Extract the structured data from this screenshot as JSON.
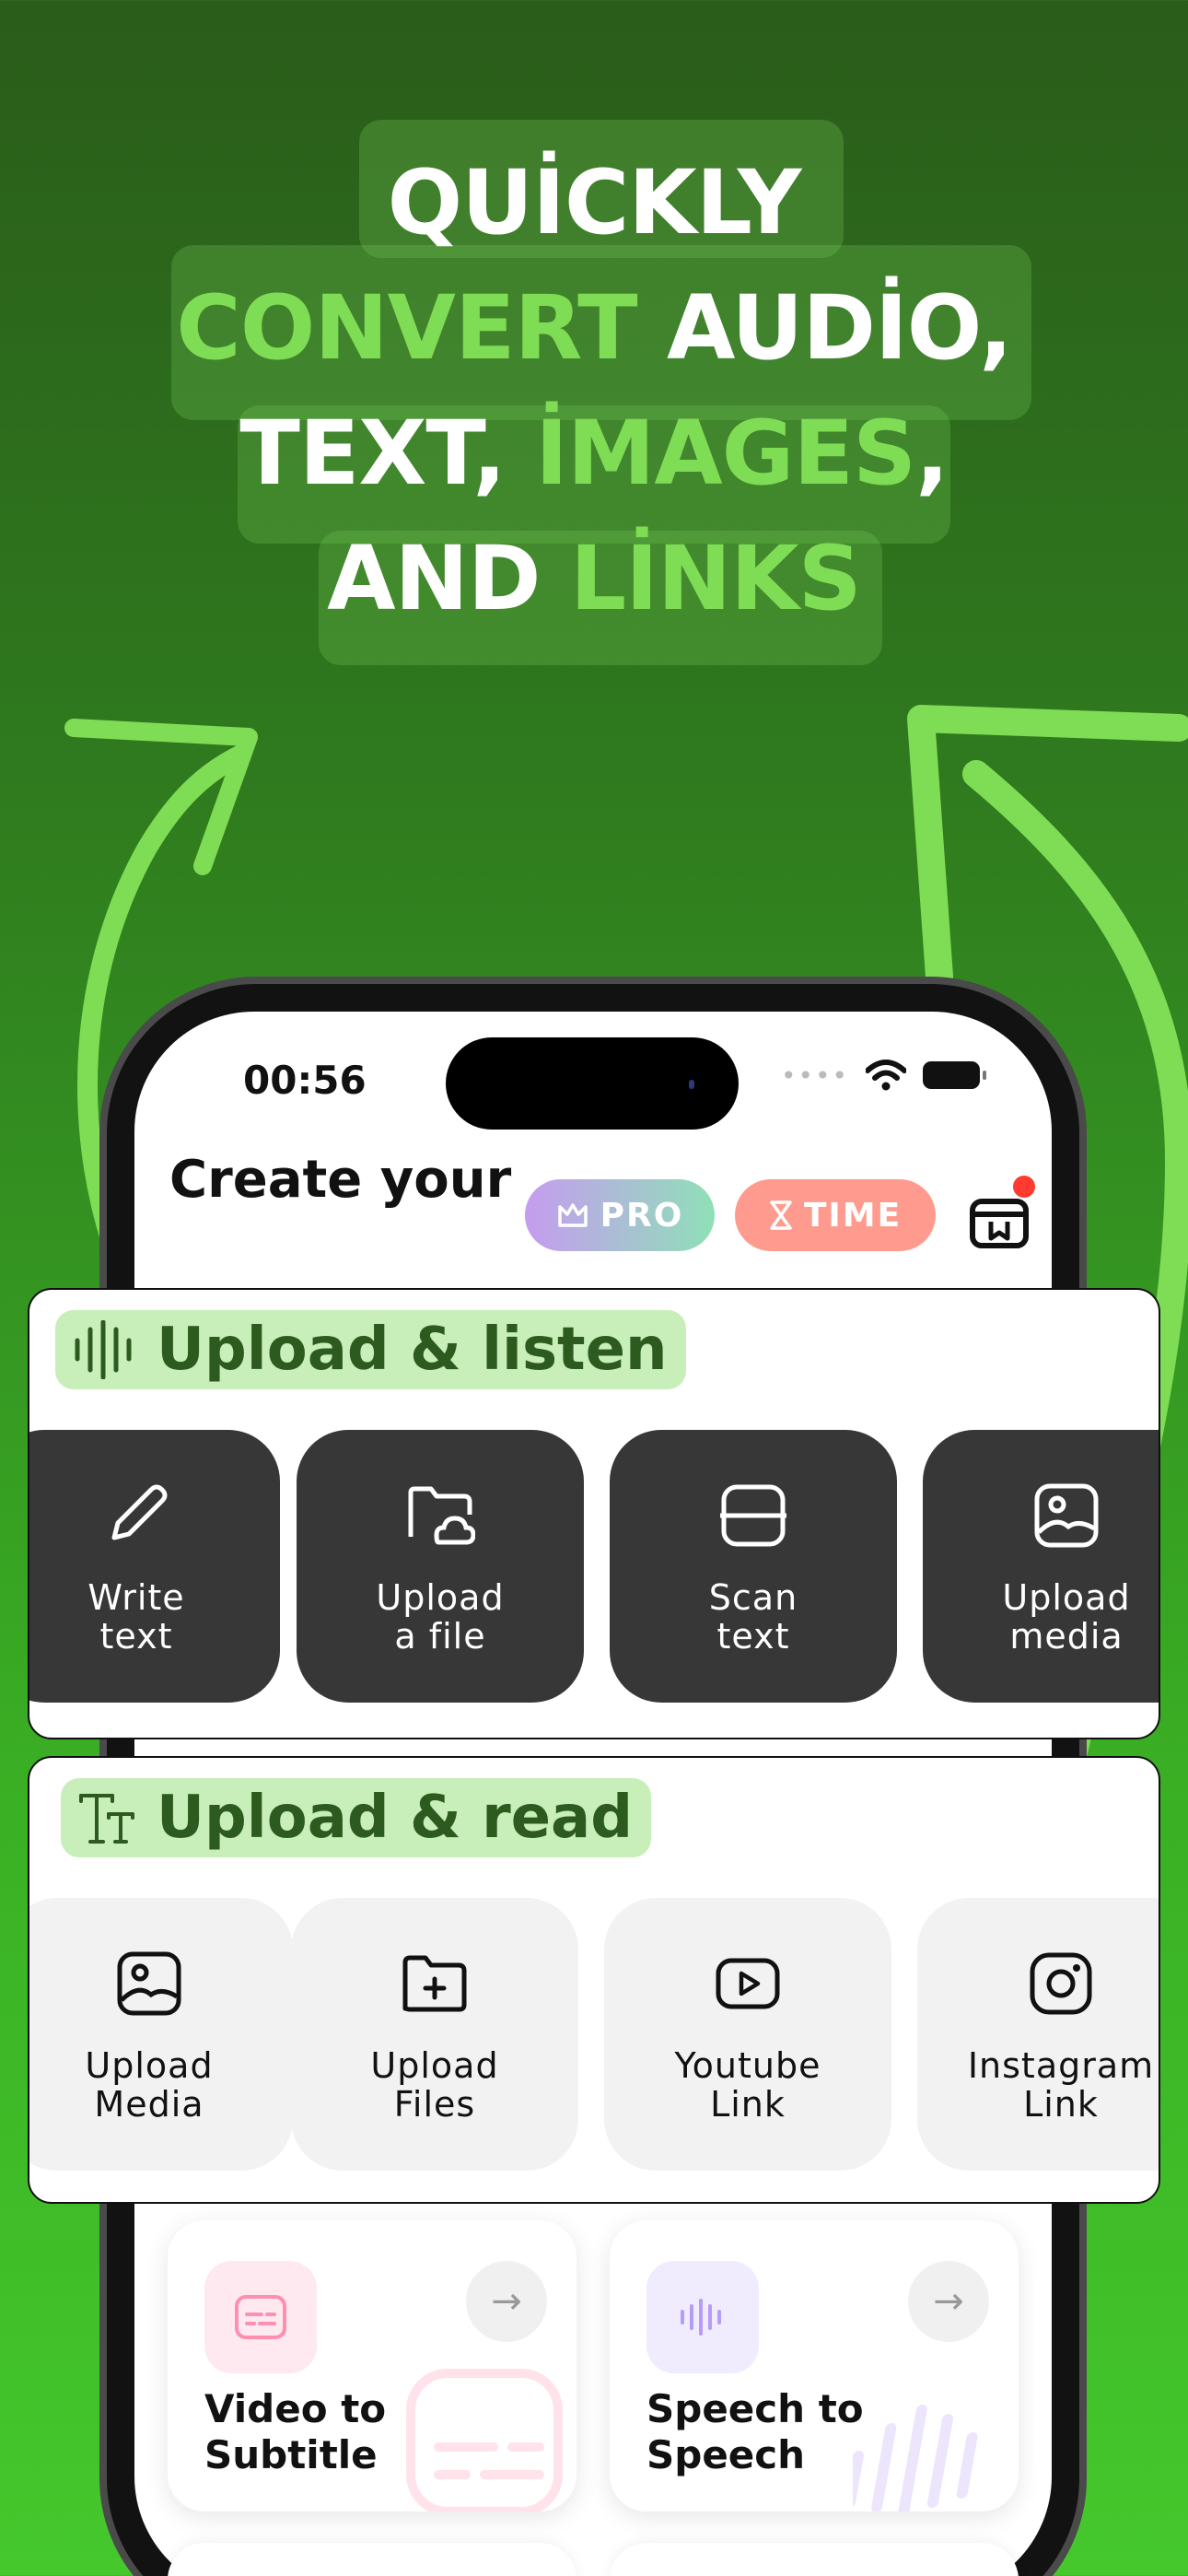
{
  "headline": {
    "line1": "QUİCKLY",
    "line2_accent": "CONVERT",
    "line2_rest": " AUDİO,",
    "line3_a": "TEXT, ",
    "line3_accent": "İMAGES",
    "line3_b": ",",
    "line4_a": "AND ",
    "line4_accent": "LİNKS"
  },
  "phone": {
    "status_time": "00:56",
    "signal_dots": "••••",
    "title": "Create your",
    "pro_label": "PRO",
    "time_label": "TIME"
  },
  "upload_listen": {
    "title": "Upload & listen",
    "tiles": [
      {
        "label": "Write\ntext",
        "icon": "pencil-icon"
      },
      {
        "label": "Upload\na file",
        "icon": "folder-cloud-icon"
      },
      {
        "label": "Scan\ntext",
        "icon": "scan-icon"
      },
      {
        "label": "Upload\nmedia",
        "icon": "image-icon"
      }
    ]
  },
  "upload_read": {
    "title": "Upload & read",
    "tiles": [
      {
        "label": "Upload\nMedia",
        "icon": "image-icon"
      },
      {
        "label": "Upload\nFiles",
        "icon": "folder-plus-icon"
      },
      {
        "label": "Youtube\nLink",
        "icon": "youtube-icon"
      },
      {
        "label": "Instagram\nLink",
        "icon": "instagram-icon"
      }
    ]
  },
  "features": [
    {
      "label": "Video to\nSubtitle",
      "icon": "subtitle-icon",
      "color": "#ff8fb0"
    },
    {
      "label": "Speech to\nSpeech",
      "icon": "waveform-icon",
      "color": "#b79cf5"
    }
  ],
  "colors": {
    "accent_green": "#7fdd55",
    "header_bg": "#c8eeba",
    "header_text": "#2d5a1f",
    "dark_tile": "#373737",
    "light_tile": "#f2f2f2"
  }
}
